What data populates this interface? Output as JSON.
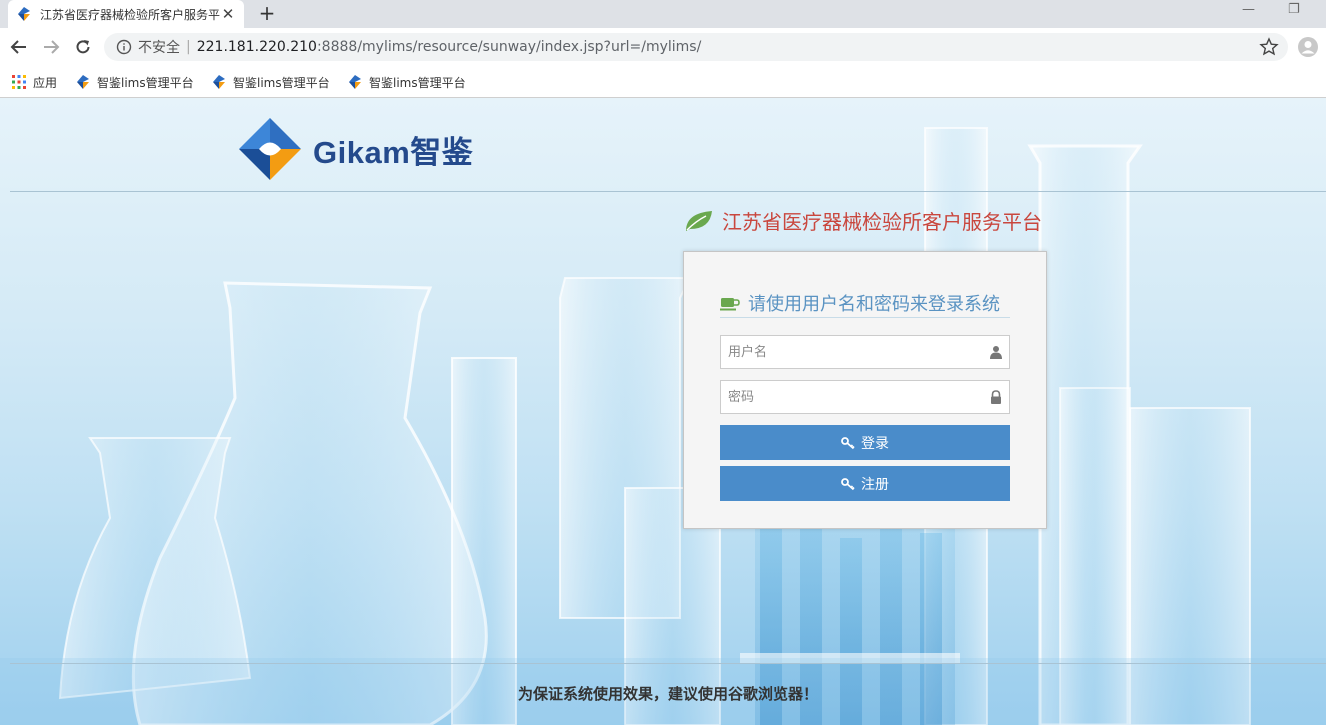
{
  "browser": {
    "tab_title": "江苏省医疗器械检验所客户服务平",
    "url_security": "不安全",
    "url_host": "221.181.220.210",
    "url_path": ":8888/mylims/resource/sunway/index.jsp?url=/mylims/",
    "bookmarks": [
      {
        "label": "应用"
      },
      {
        "label": "智鉴lims管理平台"
      },
      {
        "label": "智鉴lims管理平台"
      },
      {
        "label": "智鉴lims管理平台"
      }
    ]
  },
  "page": {
    "logo_text": "Gikam智鉴",
    "system_title": "江苏省医疗器械检验所客户服务平台",
    "login_heading": "请使用用户名和密码来登录系统",
    "username_placeholder": "用户名",
    "password_placeholder": "密码",
    "login_button": "登录",
    "register_button": "注册",
    "footer_note": "为保证系统使用效果，建议使用谷歌浏览器！"
  },
  "colors": {
    "accent_blue": "#4a8cca",
    "title_red": "#c9473e",
    "heading_blue": "#5a93c2",
    "leaf_green": "#6aa84f",
    "logo_navy": "#244a8c"
  }
}
